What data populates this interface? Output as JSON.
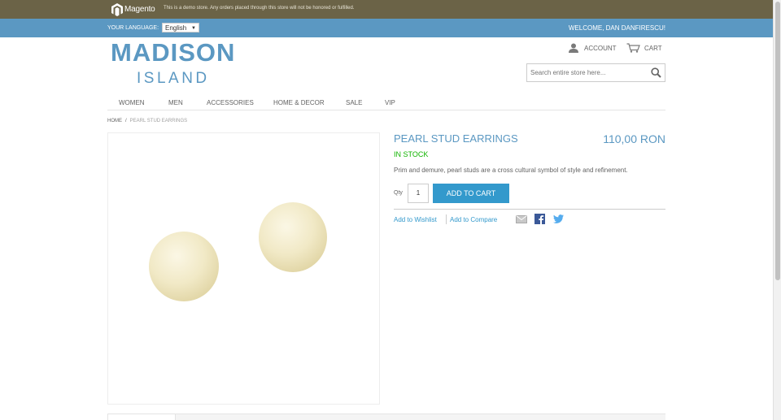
{
  "demo_bar": {
    "logo_text": "Magento",
    "notice": "This is a demo store. Any orders placed through this store will not be honored or fulfilled."
  },
  "header": {
    "language_label": "YOUR LANGUAGE:",
    "language_value": "English",
    "welcome": "WELCOME, DAN DANFIRESCU!",
    "account": "ACCOUNT",
    "cart": "CART",
    "search_placeholder": "Search entire store here..."
  },
  "logo": {
    "main": "MADISON",
    "sub": "ISLAND"
  },
  "nav": {
    "items": [
      "WOMEN",
      "MEN",
      "ACCESSORIES",
      "HOME & DECOR",
      "SALE",
      "VIP"
    ]
  },
  "breadcrumb": {
    "home": "HOME",
    "separator": "/",
    "current": "PEARL STUD EARRINGS"
  },
  "product": {
    "name": "PEARL STUD EARRINGS",
    "price": "110,00 RON",
    "stock": "IN STOCK",
    "description": "Prim and demure, pearl studs are a cross cultural symbol of style and refinement.",
    "qty_label": "Qty",
    "qty_value": "1",
    "add_to_cart": "ADD TO CART",
    "add_to_wishlist": "Add to Wishlist",
    "add_to_compare": "Add to Compare"
  },
  "colors": {
    "brand_blue": "#5b98c2",
    "button_blue": "#3399cc",
    "demo_bar": "#6b6347",
    "in_stock": "#11b400"
  },
  "icons": [
    "magento-logo-icon",
    "account-icon",
    "cart-icon",
    "search-icon",
    "email-icon",
    "facebook-icon",
    "twitter-icon"
  ]
}
